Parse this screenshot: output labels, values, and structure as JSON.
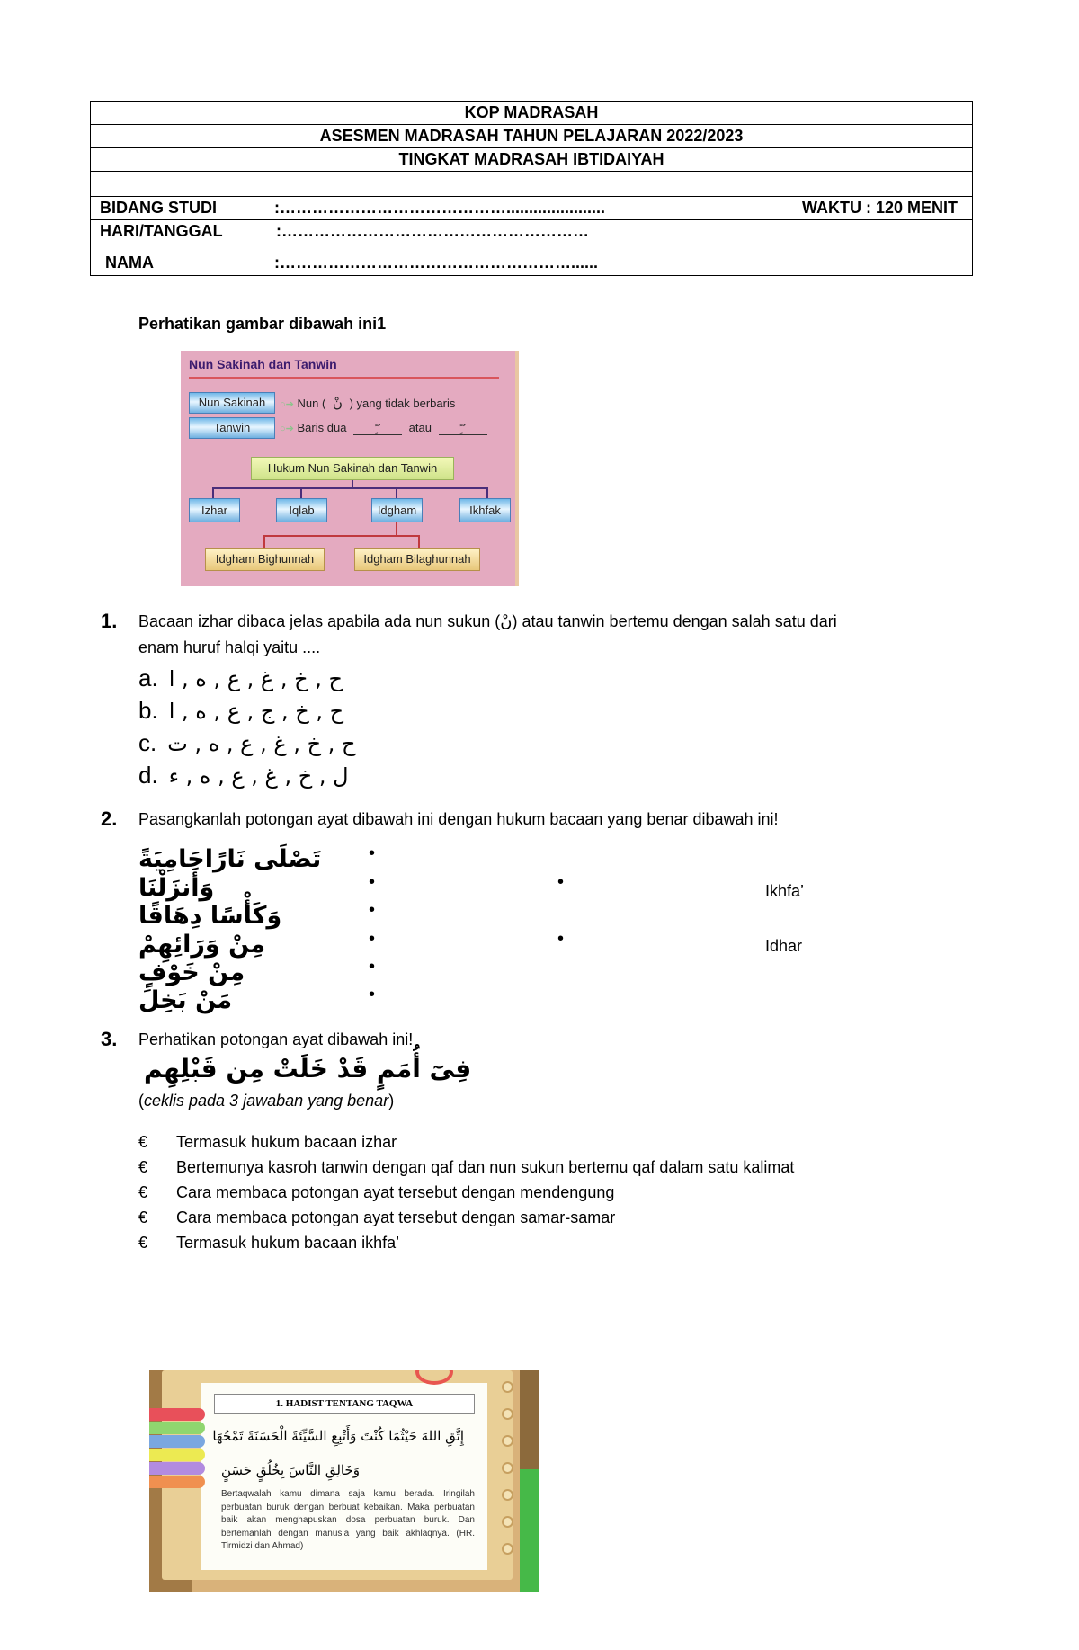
{
  "header": {
    "line1": "KOP MADRASAH",
    "line2": "ASESMEN MADRASAH TAHUN PELAJARAN 2022/2023",
    "line3": "TINGKAT MADRASAH IBTIDAIYAH",
    "fields": [
      {
        "label": "BIDANG STUDI",
        "value": ":……………………………………......................"
      },
      {
        "label": "HARI/TANGGAL",
        "value": ":…………………………………………………"
      },
      {
        "label": "NAMA",
        "value": ":………………………………………………......"
      }
    ],
    "waktu": "WAKTU  : 120 MENIT"
  },
  "instruction": "Perhatikan gambar dibawah ini1",
  "diagram": {
    "title": "Nun Sakinah dan Tanwin",
    "nun_sakinah_label": "Nun Sakinah",
    "nun_sakinah_desc_pre": "Nun (",
    "nun_glyph": "نْ",
    "nun_sakinah_desc_post": ") yang tidak berbaris",
    "tanwin_label": "Tanwin",
    "tanwin_desc": "Baris dua",
    "tanwin_glyph1": "ً ٍ ٌ",
    "atau": "atau",
    "tanwin_glyph2": "ً ٍ ٌ",
    "root": "Hukum Nun Sakinah dan Tanwin",
    "branches": [
      "Izhar",
      "Iqlab",
      "Idgham",
      "Ikhfak"
    ],
    "sub_branches": [
      "Idgham Bighunnah",
      "Idgham Bilaghunnah"
    ]
  },
  "q1": {
    "number": "1.",
    "text_line1": "Bacaan izhar dibaca jelas apabila ada nun sukun (نْ) atau tanwin bertemu dengan salah satu dari",
    "text_line2": "enam huruf halqi yaitu ....",
    "options": [
      {
        "letter": "a.",
        "value": "ح , خ , غ , ع , ه , ا"
      },
      {
        "letter": "b.",
        "value": "ح , خ , ج , ع , ه , ا"
      },
      {
        "letter": "c.",
        "value": "ح , خ , غ , ع , ه , ت"
      },
      {
        "letter": "d.",
        "value": "ل , خ , غ , ع , ه , ء"
      }
    ]
  },
  "q2": {
    "number": "2.",
    "text": "Pasangkanlah potongan ayat dibawah ini dengan hukum bacaan yang benar dibawah ini!",
    "ayat": [
      "تَصْلَى نَارًاحَامِيَةً",
      "وَأَنزَلْنَا",
      "وَكَأْسًا دِهَاقًا",
      "مِنْ وَرَائِهِمْ",
      "مِنْ خَوْفٍ",
      "مَنْ بَخِلَ"
    ],
    "bullet": "•",
    "hukum": [
      "Ikhfa’",
      "Idhar"
    ]
  },
  "q3": {
    "number": "3.",
    "text": "Perhatikan potongan ayat dibawah ini!",
    "ayat": "فِىٓ أُمَمٍ قَدْ خَلَتْ مِن قَبْلِهِم",
    "note_open": "(",
    "note": "ceklis pada 3 jawaban yang benar",
    "note_close": ")",
    "checkbox_glyph": "€",
    "choices": [
      "Termasuk hukum bacaan izhar",
      "Bertemunya kasroh tanwin dengan qaf dan nun sukun bertemu qaf dalam satu kalimat",
      "Cara membaca potongan ayat tersebut dengan mendengung",
      "Cara membaca potongan ayat tersebut dengan samar-samar",
      "Termasuk hukum bacaan ikhfa’"
    ]
  },
  "hadith_image": {
    "title": "1.      HADIST TENTANG TAQWA",
    "arabic_line1": "إِتَّقِ اللهَ حَيْثُمَا كُنْتَ وَأَتْبِعِ السَّيِّئَةَ الْحَسَنَةَ تَمْحُهَا",
    "arabic_line2": "وَخَالِقِ النَّاسَ بِخُلُقٍ حَسَنٍ",
    "translation": "Bertaqwalah kamu dimana saja kamu berada. Iringilah perbuatan buruk dengan berbuat kebaikan. Maka perbuatan baik akan menghapuskan dosa perbuatan buruk. Dan bertemanlah dengan manusia yang baik akhlaqnya. (HR. Tirmidzi dan Ahmad)",
    "tab_colors": [
      "#e8505a",
      "#8fd66f",
      "#7aa7e0",
      "#ecea52",
      "#b28be0",
      "#f09050"
    ]
  }
}
